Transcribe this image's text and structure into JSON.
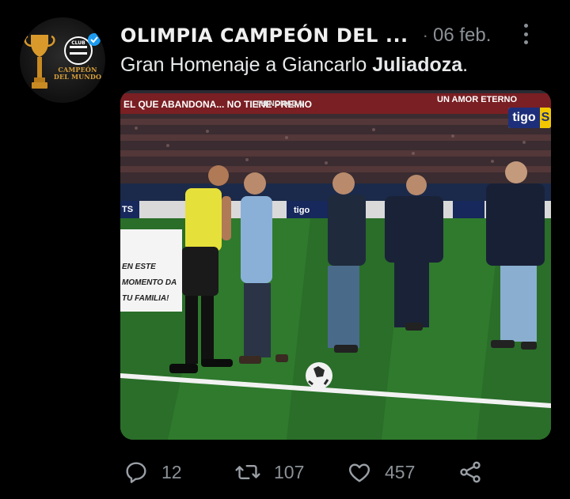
{
  "tweet": {
    "author_name": "OLIMPIA CAMPEÓN DEL ...",
    "separator": "·",
    "date": "06 feb.",
    "text_plain": "Gran Homenaje a Giancarlo ",
    "text_bold": "Juliadoza",
    "text_end": "."
  },
  "avatar": {
    "label_line1": "CAMPEÓN",
    "label_line2": "DEL MUNDO",
    "badge_color": "#1d9bf0"
  },
  "media": {
    "banner_left": "EL QUE ABANDONA... NO TIENE PREMIO",
    "banner_mid": "#HINCHADA",
    "banner_right": "UN AMOR ETERNO",
    "ad_board_left": "TS",
    "ad_board_tigo": "tigo",
    "broadcaster_logo_main": "tigo",
    "broadcaster_logo_suffix": "S",
    "sideboard_text": "EN ESTE MOMENTO DA TU FAMILIA!"
  },
  "actions": {
    "reply_count": "12",
    "retweet_count": "107",
    "like_count": "457"
  },
  "colors": {
    "background": "#000000",
    "text": "#e7e9ea",
    "muted": "#8b9196",
    "pitch": "#2c6b2a"
  },
  "icons": [
    "verified-badge-icon",
    "more-options-icon",
    "reply-icon",
    "retweet-icon",
    "like-icon",
    "share-icon"
  ]
}
